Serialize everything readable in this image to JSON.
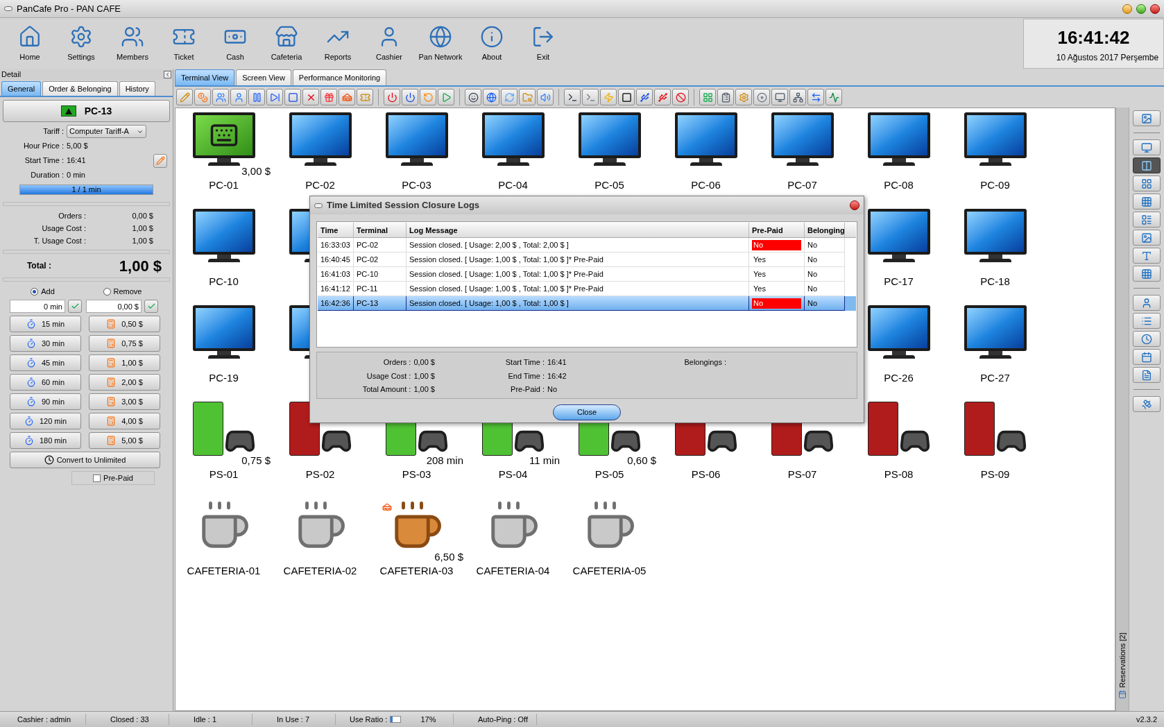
{
  "window": {
    "title": "PanCafe Pro - PAN CAFE"
  },
  "main_toolbar": [
    {
      "label": "Home"
    },
    {
      "label": "Settings"
    },
    {
      "label": "Members"
    },
    {
      "label": "Ticket"
    },
    {
      "label": "Cash"
    },
    {
      "label": "Cafeteria"
    },
    {
      "label": "Reports"
    },
    {
      "label": "Cashier"
    },
    {
      "label": "Pan Network"
    },
    {
      "label": "About"
    },
    {
      "label": "Exit"
    }
  ],
  "clock": {
    "time": "16:41:42",
    "date": "10 Ağustos 2017 Perşembe"
  },
  "detail": {
    "title": "Detail",
    "tabs": [
      {
        "label": "General",
        "selected": true
      },
      {
        "label": "Order & Belonging",
        "selected": false
      },
      {
        "label": "History",
        "selected": false
      }
    ],
    "terminal": "PC-13",
    "fields": [
      {
        "label": "Tariff :",
        "value": "Computer Tariff-A",
        "kind": "select"
      },
      {
        "label": "Hour Price :",
        "value": "5,00 $",
        "kind": "text"
      },
      {
        "label": "Start Time :",
        "value": "16:41",
        "kind": "editable"
      },
      {
        "label": "Duration :",
        "value": "0 min",
        "kind": "text"
      }
    ],
    "progress": {
      "text": "1 / 1 min",
      "level": 1
    },
    "costs": [
      {
        "label": "Orders :",
        "value": "0,00 $"
      },
      {
        "label": "Usage Cost :",
        "value": "1,00 $"
      },
      {
        "label": "T. Usage Cost :",
        "value": "1,00 $"
      }
    ],
    "total": {
      "label": "Total :",
      "value": "1,00 $"
    },
    "modes": [
      {
        "label": "Add",
        "selected": true
      },
      {
        "label": "Remove",
        "selected": false
      }
    ],
    "time_input": "0 min",
    "money_input": "0,00 $",
    "time_buttons": [
      "15 min",
      "30 min",
      "45 min",
      "60 min",
      "90 min",
      "120 min",
      "180 min"
    ],
    "money_buttons": [
      "0,50 $",
      "0,75 $",
      "1,00 $",
      "2,00 $",
      "3,00 $",
      "4,00 $",
      "5,00 $"
    ],
    "convert_button": "Convert to Unlimited",
    "prepaid": {
      "label": "Pre-Paid",
      "checked": false
    }
  },
  "view_tabs": [
    {
      "label": "Terminal View",
      "selected": true
    },
    {
      "label": "Screen View",
      "selected": false
    },
    {
      "label": "Performance Monitoring",
      "selected": false
    }
  ],
  "terminal_rows": [
    [
      {
        "kind": "pc",
        "label": "PC-01",
        "active": true,
        "badge": "3,00 $"
      },
      {
        "kind": "pc",
        "label": "PC-02",
        "active": false
      },
      {
        "kind": "pc",
        "label": "PC-03",
        "active": false
      },
      {
        "kind": "pc",
        "label": "PC-04",
        "active": false
      },
      {
        "kind": "pc",
        "label": "PC-05",
        "active": false
      },
      {
        "kind": "pc",
        "label": "PC-06",
        "active": false
      },
      {
        "kind": "pc",
        "label": "PC-07",
        "active": false
      },
      {
        "kind": "pc",
        "label": "PC-08",
        "active": false
      },
      {
        "kind": "pc",
        "label": "PC-09",
        "active": false
      }
    ],
    [
      {
        "kind": "pc",
        "label": "PC-10",
        "active": false
      },
      {
        "kind": "covered"
      },
      {
        "kind": "covered"
      },
      {
        "kind": "covered"
      },
      {
        "kind": "covered"
      },
      {
        "kind": "covered"
      },
      {
        "kind": "covered"
      },
      {
        "kind": "pc",
        "label": "PC-17",
        "active": false
      },
      {
        "kind": "pc",
        "label": "PC-18",
        "active": false
      }
    ],
    [
      {
        "kind": "pc",
        "label": "PC-19",
        "active": false
      },
      {
        "kind": "covered"
      },
      {
        "kind": "covered"
      },
      {
        "kind": "covered"
      },
      {
        "kind": "covered"
      },
      {
        "kind": "covered"
      },
      {
        "kind": "covered"
      },
      {
        "kind": "pc",
        "label": "PC-26",
        "active": false
      },
      {
        "kind": "pc",
        "label": "PC-27",
        "active": false
      }
    ],
    [
      {
        "kind": "ps",
        "label": "PS-01",
        "active": true,
        "badge": "0,75 $"
      },
      {
        "kind": "ps",
        "label": "PS-02",
        "active": false
      },
      {
        "kind": "ps",
        "label": "PS-03",
        "active": true,
        "badge": "208 min"
      },
      {
        "kind": "ps",
        "label": "PS-04",
        "active": true,
        "badge": "11 min"
      },
      {
        "kind": "ps",
        "label": "PS-05",
        "active": true,
        "badge": "0,60 $"
      },
      {
        "kind": "ps",
        "label": "PS-06",
        "active": false
      },
      {
        "kind": "ps",
        "label": "PS-07",
        "active": false
      },
      {
        "kind": "ps",
        "label": "PS-08",
        "active": false
      },
      {
        "kind": "ps",
        "label": "PS-09",
        "active": false
      }
    ],
    [
      {
        "kind": "cafe",
        "label": "CAFETERIA-01",
        "active": false
      },
      {
        "kind": "cafe",
        "label": "CAFETERIA-02",
        "active": false
      },
      {
        "kind": "cafe",
        "label": "CAFETERIA-03",
        "active": true,
        "badge": "6,50 $"
      },
      {
        "kind": "cafe",
        "label": "CAFETERIA-04",
        "active": false
      },
      {
        "kind": "cafe",
        "label": "CAFETERIA-05",
        "active": false
      }
    ]
  ],
  "dialog": {
    "title": "Time Limited Session Closure Logs",
    "columns": [
      "Time",
      "Terminal",
      "Log Message",
      "Pre-Paid",
      "Belonging"
    ],
    "rows": [
      {
        "time": "16:33:03",
        "terminal": "PC-02",
        "message": "Session closed. [ Usage: 2,00 $ , Total: 2,00 $ ]",
        "prepaid": "No",
        "prepaid_alert": true,
        "belonging": "No",
        "selected": false
      },
      {
        "time": "16:40:45",
        "terminal": "PC-02",
        "message": "Session closed. [ Usage: 1,00 $ , Total: 1,00 $ ]* Pre-Paid",
        "prepaid": "Yes",
        "prepaid_alert": false,
        "belonging": "No",
        "selected": false
      },
      {
        "time": "16:41:03",
        "terminal": "PC-10",
        "message": "Session closed. [ Usage: 1,00 $ , Total: 1,00 $ ]* Pre-Paid",
        "prepaid": "Yes",
        "prepaid_alert": false,
        "belonging": "No",
        "selected": false
      },
      {
        "time": "16:41:12",
        "terminal": "PC-11",
        "message": "Session closed. [ Usage: 1,00 $ , Total: 1,00 $ ]* Pre-Paid",
        "prepaid": "Yes",
        "prepaid_alert": false,
        "belonging": "No",
        "selected": false
      },
      {
        "time": "16:42:36",
        "terminal": "PC-13",
        "message": "Session closed. [ Usage: 1,00 $ , Total: 1,00 $ ]",
        "prepaid": "No",
        "prepaid_alert": true,
        "belonging": "No",
        "selected": true
      }
    ],
    "summary_left": [
      {
        "label": "Orders :",
        "value": "0,00 $"
      },
      {
        "label": "Usage Cost :",
        "value": "1,00 $"
      },
      {
        "label": "Total Amount :",
        "value": "1,00 $"
      }
    ],
    "summary_mid": [
      {
        "label": "Start Time :",
        "value": "16:41"
      },
      {
        "label": "End Time :",
        "value": "16:42"
      },
      {
        "label": "Pre-Paid :",
        "value": "No"
      }
    ],
    "summary_right": [
      {
        "label": "Belongings :"
      }
    ],
    "close_button": "Close"
  },
  "reservations": "Reservations [2]",
  "status_bar": {
    "items": [
      {
        "kind": "text",
        "text": "Cashier : admin"
      },
      {
        "kind": "text",
        "text": "Closed : 33"
      },
      {
        "kind": "text",
        "text": "Idle : 1"
      },
      {
        "kind": "text",
        "text": "In Use : 7"
      },
      {
        "kind": "meter",
        "text": "Use Ratio :",
        "level": 0.17,
        "reading": "17%"
      },
      {
        "kind": "text",
        "text": "Auto-Ping : Off"
      }
    ],
    "version": "v2.3.2"
  }
}
